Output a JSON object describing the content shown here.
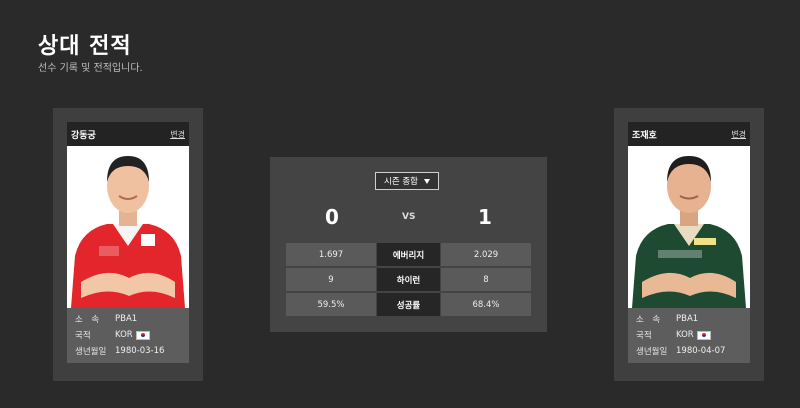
{
  "page": {
    "title": "상대 전적",
    "subtitle": "선수 기록 및 전적입니다."
  },
  "left_player": {
    "name": "강동궁",
    "change_label": "변경",
    "rows": [
      {
        "key": "소　속",
        "value": "PBA1"
      },
      {
        "key": "국적",
        "value": "KOR"
      },
      {
        "key": "생년월일",
        "value": "1980-03-16"
      }
    ],
    "shirt_color": "#e2262b"
  },
  "right_player": {
    "name": "조재호",
    "change_label": "변경",
    "rows": [
      {
        "key": "소　속",
        "value": "PBA1"
      },
      {
        "key": "국적",
        "value": "KOR"
      },
      {
        "key": "생년월일",
        "value": "1980-04-07"
      }
    ],
    "shirt_color": "#1f4a32"
  },
  "comparison": {
    "season_select": "시즌 종합",
    "left_score": "0",
    "vs": "VS",
    "right_score": "1",
    "stats": [
      {
        "left": "1.697",
        "label": "에버리지",
        "right": "2.029"
      },
      {
        "left": "9",
        "label": "하이런",
        "right": "8"
      },
      {
        "left": "59.5%",
        "label": "성공률",
        "right": "68.4%"
      }
    ]
  }
}
